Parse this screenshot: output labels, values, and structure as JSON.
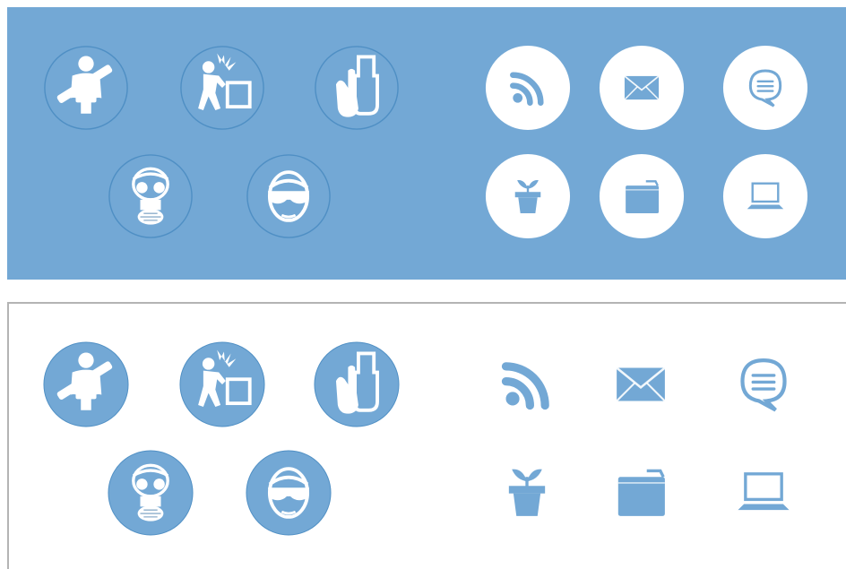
{
  "colors": {
    "brand_blue": "#73a8d5",
    "ring_blue": "#4f8fc4",
    "white": "#ffffff",
    "frame_gray": "#b4b4b4"
  },
  "panels": [
    {
      "theme": "blue-background",
      "safety_icons": [
        "seatbelt-icon",
        "back-injury-lifting-icon",
        "gloves-icon",
        "gas-mask-icon",
        "safety-glasses-icon"
      ],
      "ui_icons": [
        "rss-icon",
        "mail-icon",
        "chat-icon",
        "plant-pot-icon",
        "folder-icon",
        "laptop-icon"
      ]
    },
    {
      "theme": "white-background",
      "safety_icons": [
        "seatbelt-icon",
        "back-injury-lifting-icon",
        "gloves-icon",
        "gas-mask-icon",
        "safety-glasses-icon"
      ],
      "ui_icons": [
        "rss-icon",
        "mail-icon",
        "chat-icon",
        "plant-pot-icon",
        "folder-icon",
        "laptop-icon"
      ]
    }
  ]
}
